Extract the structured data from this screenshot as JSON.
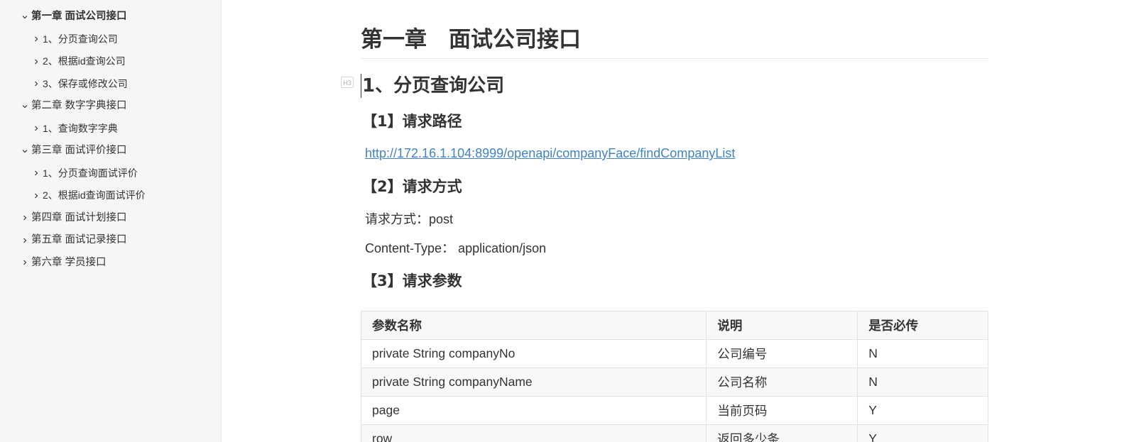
{
  "sidebar": {
    "items": [
      {
        "label": "第一章 面试公司接口",
        "level": 1,
        "expanded": true,
        "bold": true
      },
      {
        "label": "1、分页查询公司",
        "level": 2,
        "expanded": false
      },
      {
        "label": "2、根据id查询公司",
        "level": 2,
        "expanded": false
      },
      {
        "label": "3、保存或修改公司",
        "level": 2,
        "expanded": false
      },
      {
        "label": "第二章 数字字典接口",
        "level": 1,
        "expanded": true
      },
      {
        "label": "1、查询数字字典",
        "level": 2,
        "expanded": false
      },
      {
        "label": "第三章 面试评价接口",
        "level": 1,
        "expanded": true
      },
      {
        "label": "1、分页查询面试评价",
        "level": 2,
        "expanded": false
      },
      {
        "label": "2、根据id查询面试评价",
        "level": 2,
        "expanded": false
      },
      {
        "label": "第四章 面试计划接口",
        "level": 1,
        "expanded": false
      },
      {
        "label": "第五章 面试记录接口",
        "level": 1,
        "expanded": false
      },
      {
        "label": "第六章 学员接口",
        "level": 1,
        "expanded": false
      }
    ]
  },
  "doc": {
    "h1": "第一章　面试公司接口",
    "h3_badge": "H3",
    "h3": "1、分页查询公司",
    "section1_title": "【1】请求路径",
    "url": "http://172.16.1.104:8999/openapi/companyFace/findCompanyList",
    "section2_title": "【2】请求方式",
    "method_text": "请求方式：post",
    "content_type_text": "Content-Type：  application/json",
    "section3_title": "【3】请求参数",
    "table": {
      "headers": [
        "参数名称",
        "说明",
        "是否必传"
      ],
      "rows": [
        [
          "private String companyNo",
          "公司编号",
          "N"
        ],
        [
          "private String companyName",
          "公司名称",
          "N"
        ],
        [
          "page",
          "当前页码",
          "Y"
        ],
        [
          "row",
          "返回多少条",
          "Y"
        ]
      ]
    }
  },
  "colors": {
    "sidebar_bg": "#f6f6f6",
    "link": "#4183c4",
    "text": "#333333"
  }
}
